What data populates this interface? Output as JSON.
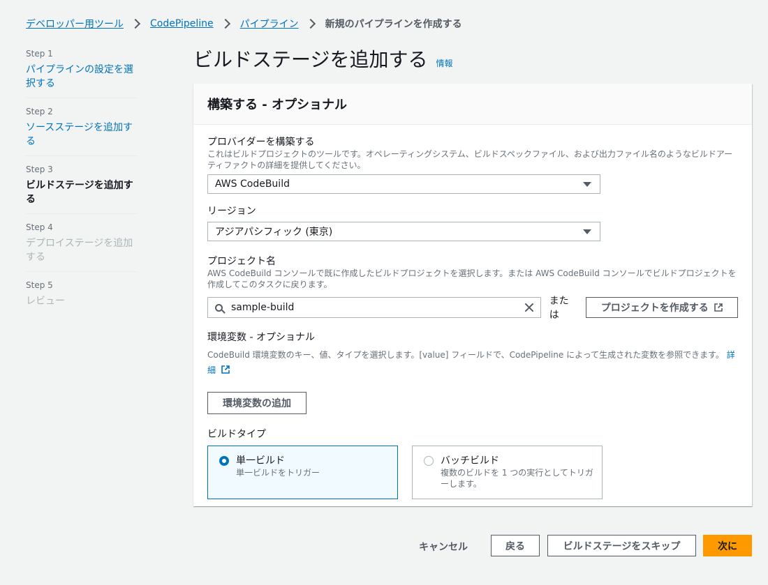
{
  "breadcrumb": {
    "items": [
      "デベロッパー用ツール",
      "CodePipeline",
      "パイプライン"
    ],
    "current": "新規のパイプラインを作成する"
  },
  "steps": [
    {
      "num": "Step 1",
      "label": "パイプラインの設定を選択する",
      "state": "link"
    },
    {
      "num": "Step 2",
      "label": "ソースステージを追加する",
      "state": "link"
    },
    {
      "num": "Step 3",
      "label": "ビルドステージを追加する",
      "state": "current"
    },
    {
      "num": "Step 4",
      "label": "デプロイステージを追加する",
      "state": "disabled"
    },
    {
      "num": "Step 5",
      "label": "レビュー",
      "state": "disabled"
    }
  ],
  "page": {
    "title": "ビルドステージを追加する",
    "info": "情報"
  },
  "panel": {
    "title": "構築する - オプショナル",
    "provider": {
      "label": "プロバイダーを構築する",
      "desc": "これはビルドプロジェクトのツールです。オペレーティングシステム、ビルドスペックファイル、および出力ファイル名のようなビルドアーティファクトの詳細を提供してください。",
      "value": "AWS CodeBuild"
    },
    "region": {
      "label": "リージョン",
      "value": "アジアパシフィック (東京)"
    },
    "project": {
      "label": "プロジェクト名",
      "desc": "AWS CodeBuild コンソールで既に作成したビルドプロジェクトを選択します。または AWS CodeBuild コンソールでビルドプロジェクトを作成してこのタスクに戻ります。",
      "value": "sample-build",
      "or": "または",
      "create_button": "プロジェクトを作成する"
    },
    "env": {
      "label": "環境変数 - オプショナル",
      "desc": "CodeBuild 環境変数のキー、値、タイプを選択します。[value] フィールドで、CodePipeline によって生成された変数を参照できます。",
      "more": "詳細",
      "add_button": "環境変数の追加"
    },
    "build_type": {
      "label": "ビルドタイプ",
      "options": [
        {
          "title": "単一ビルド",
          "desc": "単一ビルドをトリガー",
          "selected": true
        },
        {
          "title": "バッチビルド",
          "desc": "複数のビルドを 1 つの実行としてトリガーします。",
          "selected": false
        }
      ]
    }
  },
  "footer": {
    "cancel": "キャンセル",
    "back": "戻る",
    "skip": "ビルドステージをスキップ",
    "next": "次に"
  },
  "colors": {
    "link": "#0073bb",
    "primary": "#ff9900",
    "background": "#f2f3f3"
  }
}
